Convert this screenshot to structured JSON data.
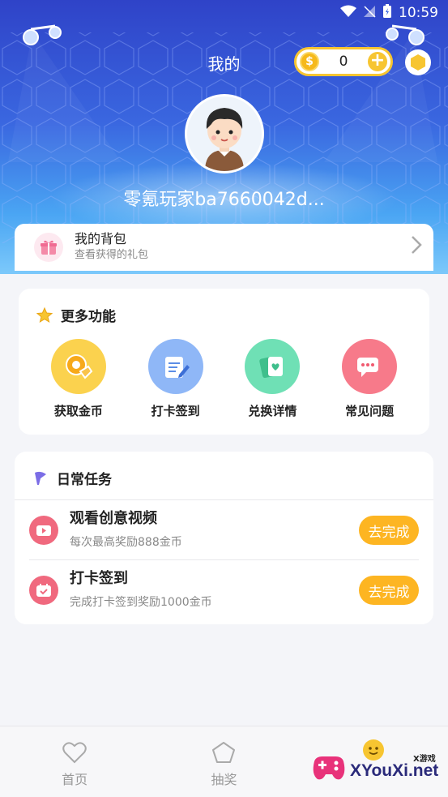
{
  "status_bar": {
    "time": "10:59"
  },
  "header": {
    "title": "我的",
    "coins": "0",
    "username": "零氪玩家ba7660042d..."
  },
  "backpack": {
    "title": "我的背包",
    "subtitle": "查看获得的礼包"
  },
  "more_functions": {
    "title": "更多功能",
    "items": [
      {
        "label": "获取金币",
        "icon": "coin-hand-icon",
        "color": "#fbd24e"
      },
      {
        "label": "打卡签到",
        "icon": "checkin-icon",
        "color": "#8fb7f7"
      },
      {
        "label": "兑换详情",
        "icon": "cards-icon",
        "color": "#6fe0b5"
      },
      {
        "label": "常见问题",
        "icon": "chat-icon",
        "color": "#f77a8a"
      }
    ]
  },
  "daily_tasks": {
    "title": "日常任务",
    "tasks": [
      {
        "title": "观看创意视频",
        "subtitle": "每次最高奖励888金币",
        "button": "去完成"
      },
      {
        "title": "打卡签到",
        "subtitle": "完成打卡签到奖励1000金币",
        "button": "去完成"
      }
    ]
  },
  "bottom_nav": [
    {
      "label": "首页",
      "icon": "heart-icon"
    },
    {
      "label": "抽奖",
      "icon": "pentagon-icon"
    },
    {
      "label": "",
      "icon": "smiley-icon"
    }
  ],
  "watermark": {
    "text": "XYouXi.net",
    "small": "X游戏"
  },
  "colors": {
    "accent": "#fdb522",
    "header_top": "#2f43c8",
    "header_bottom": "#7cc9fb"
  }
}
